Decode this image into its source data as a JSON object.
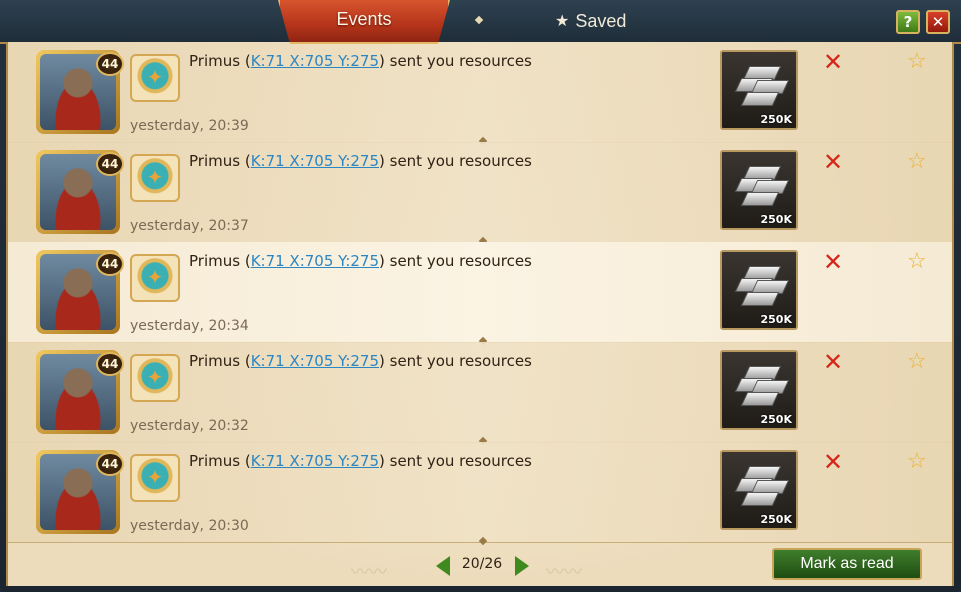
{
  "header": {
    "tab_events": "Events",
    "tab_saved": "Saved",
    "help_label": "?",
    "close_label": "✕"
  },
  "rows": [
    {
      "level": "44",
      "sender": "Primus",
      "coords": "K:71 X:705 Y:275",
      "text_after": ") sent you resources",
      "time": "yesterday, 20:39",
      "amount": "250K"
    },
    {
      "level": "44",
      "sender": "Primus",
      "coords": "K:71 X:705 Y:275",
      "text_after": ") sent you resources",
      "time": "yesterday, 20:37",
      "amount": "250K"
    },
    {
      "level": "44",
      "sender": "Primus",
      "coords": "K:71 X:705 Y:275",
      "text_after": ") sent you resources",
      "time": "yesterday, 20:34",
      "amount": "250K"
    },
    {
      "level": "44",
      "sender": "Primus",
      "coords": "K:71 X:705 Y:275",
      "text_after": ") sent you resources",
      "time": "yesterday, 20:32",
      "amount": "250K"
    },
    {
      "level": "44",
      "sender": "Primus",
      "coords": "K:71 X:705 Y:275",
      "text_after": ") sent you resources",
      "time": "yesterday, 20:30",
      "amount": "250K"
    }
  ],
  "footer": {
    "page": "20/26",
    "mark_read_label": "Mark as read"
  },
  "icons": {
    "delete": "close-x-icon",
    "favorite": "star-outline-icon",
    "resource": "silver-ingots-icon",
    "prev": "arrow-left-icon",
    "next": "arrow-right-icon"
  },
  "colors": {
    "tab_active": "#c8401f",
    "link": "#2b86c4",
    "delete": "#d4271a",
    "star": "#e8b23a",
    "button_green": "#2f6a1f"
  }
}
